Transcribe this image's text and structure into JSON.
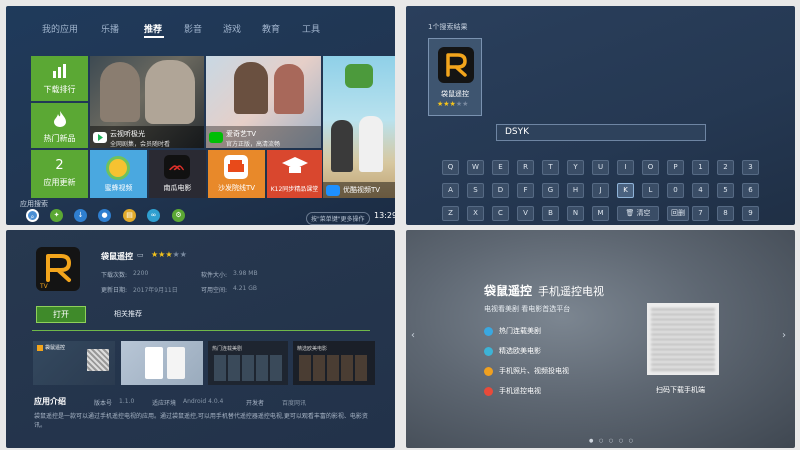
{
  "home": {
    "nav": [
      "我的应用",
      "乐播",
      "推荐",
      "影音",
      "游戏",
      "教育",
      "工具"
    ],
    "tiles_green": [
      {
        "label": "下载排行",
        "icon": "bar-chart-icon"
      },
      {
        "label": "热门新品",
        "icon": "flame-icon"
      },
      {
        "label": "应用更新",
        "value": "2"
      }
    ],
    "media": [
      {
        "label": "云视听极光",
        "sub1": "全网剧集，会员随时看"
      },
      {
        "label": "爱奇艺TV",
        "sub1": "官方正版，高清流畅"
      },
      {
        "label": "优酷视频TV"
      }
    ],
    "apps": [
      "蜜蜂视频",
      "南瓜电影",
      "沙发院线TV",
      "K12同步精品课堂"
    ],
    "k12_caption": "K12同步精品课堂",
    "dock_label": "应用搜索",
    "search_hint": "按\"菜单键\"更多操作",
    "clock": "13:29"
  },
  "search": {
    "results_count": "1个搜索结果",
    "result_name": "袋鼠遥控",
    "rating": 3,
    "query": "DSYK",
    "keys_row1": [
      "Q",
      "W",
      "E",
      "R",
      "T",
      "Y",
      "U",
      "I",
      "O",
      "P",
      "1",
      "2",
      "3"
    ],
    "keys_row2": [
      "A",
      "S",
      "D",
      "F",
      "G",
      "H",
      "J",
      "K",
      "L",
      "0",
      "4",
      "5",
      "6"
    ],
    "keys_row3": [
      "Z",
      "X",
      "C",
      "V",
      "B",
      "N",
      "M"
    ],
    "clear": "清空",
    "back": "回删",
    "keys_row3_nums": [
      "7",
      "8",
      "9"
    ],
    "selected_key": "K"
  },
  "detail": {
    "name": "袋鼠遥控",
    "rating": 3,
    "downloads_k": "下载次数:",
    "downloads_v": "2200",
    "size_k": "软件大小:",
    "size_v": "3.98 MB",
    "date_k": "更新日期:",
    "date_v": "2017年9月11日",
    "space_k": "可用空间:",
    "space_v": "4.21 GB",
    "btn_open": "打开",
    "btn_related": "相关推荐",
    "shot_captions": [
      "袋鼠遥控",
      "电视看美剧 看电影首选平台",
      "热门连载美剧",
      "精选欧美电影"
    ],
    "intro_title": "应用介绍",
    "ver_k": "版本号",
    "ver_v": "1.1.0",
    "env_k": "适应环境",
    "env_v": "Android 4.0.4",
    "dev_k": "开发者",
    "dev_v": "百度网讯",
    "desc": "袋鼠遥控是一款可以通过手机遥控电视的应用。通过袋鼠遥控,可以用手机替代遥控器遥控电视,更可以观看丰富的影视、电影资讯。"
  },
  "promo": {
    "title": "袋鼠遥控",
    "title2": "手机遥控电视",
    "subtitle": "电视看美剧 看电影首选平台",
    "features": [
      {
        "text": "热门连载美剧",
        "color": "#3aa8e0"
      },
      {
        "text": "精选欧美电影",
        "color": "#3db3d6"
      },
      {
        "text": "手机照片、视频投电视",
        "color": "#f0a020"
      },
      {
        "text": "手机遥控电视",
        "color": "#e84a3a"
      }
    ],
    "qr_caption": "扫码下载手机端"
  },
  "colors": {
    "green": "#5ba834",
    "accent": "#f3a51c",
    "bg_dark": "#213652"
  }
}
